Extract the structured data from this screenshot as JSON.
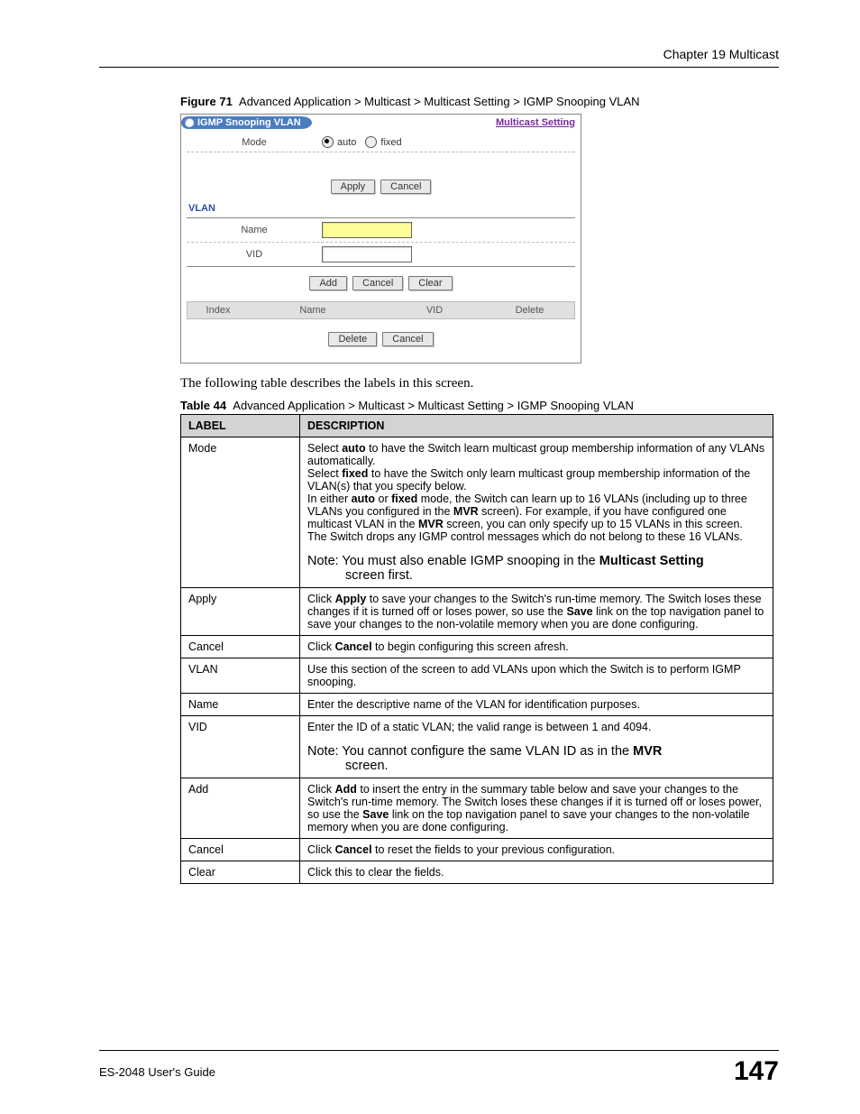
{
  "header": {
    "chapter": "Chapter 19 Multicast"
  },
  "figure": {
    "label": "Figure 71",
    "caption": "Advanced Application > Multicast > Multicast Setting > IGMP Snooping VLAN"
  },
  "panel": {
    "tab": "IGMP Snooping VLAN",
    "link": "Multicast Setting",
    "mode_label": "Mode",
    "radio_auto": "auto",
    "radio_fixed": "fixed",
    "btn_apply": "Apply",
    "btn_cancel": "Cancel",
    "vlan_heading": "VLAN",
    "name_label": "Name",
    "vid_label": "VID",
    "btn_add": "Add",
    "btn_cancel2": "Cancel",
    "btn_clear": "Clear",
    "cols": {
      "index": "Index",
      "name": "Name",
      "vid": "VID",
      "delete": "Delete"
    },
    "btn_delete": "Delete",
    "btn_cancel3": "Cancel"
  },
  "body_text": "The following table describes the labels in this screen.",
  "table_caption": {
    "label": "Table 44",
    "caption": "Advanced Application > Multicast > Multicast Setting > IGMP Snooping VLAN"
  },
  "table_headers": {
    "label": "LABEL",
    "desc": "DESCRIPTION"
  },
  "rows": {
    "mode": {
      "label": "Mode",
      "p1a": "Select ",
      "p1b": "auto",
      "p1c": " to have the Switch learn multicast group membership information of any VLANs automatically.",
      "p2a": "Select ",
      "p2b": "fixed",
      "p2c": " to have the Switch only learn multicast group membership information of the VLAN(s) that you specify below.",
      "p3a": "In either ",
      "p3b": "auto",
      "p3c": " or ",
      "p3d": "fixed",
      "p3e": " mode, the Switch can learn up to 16 VLANs (including up to three VLANs you configured in the ",
      "p3f": "MVR",
      "p3g": " screen). For example, if you have configured one multicast VLAN in the ",
      "p3h": "MVR",
      "p3i": " screen, you can only specify up to 15 VLANs in this screen.",
      "p4": "The Switch drops any IGMP control messages which do not belong to these 16 VLANs.",
      "note_a": "Note: You must also enable IGMP snooping in the ",
      "note_b": "Multicast Setting",
      "note_c": " screen first."
    },
    "apply": {
      "label": "Apply",
      "a": "Click ",
      "b": "Apply",
      "c": " to save your changes to the Switch's run-time memory. The Switch loses these changes if it is turned off or loses power, so use the ",
      "d": "Save",
      "e": " link on the top navigation panel to save your changes to the non-volatile memory when you are done configuring."
    },
    "cancel": {
      "label": "Cancel",
      "a": "Click ",
      "b": "Cancel",
      "c": " to begin configuring this screen afresh."
    },
    "vlan": {
      "label": "VLAN",
      "text": "Use this section of the screen to add VLANs upon which the Switch is to perform IGMP snooping."
    },
    "name": {
      "label": "Name",
      "text": "Enter the descriptive name of the VLAN for identification purposes."
    },
    "vid": {
      "label": "VID",
      "text": "Enter the ID of a static VLAN; the valid range is between 1 and 4094.",
      "note_a": "Note: You cannot configure the same VLAN ID as in the ",
      "note_b": "MVR",
      "note_c": " screen."
    },
    "add": {
      "label": "Add",
      "a": "Click ",
      "b": "Add",
      "c": " to insert the entry in the summary table below and save your changes to the Switch's run-time memory. The Switch loses these changes if it is turned off or loses power, so use the ",
      "d": "Save",
      "e": " link on the top navigation panel to save your changes to the non-volatile memory when you are done configuring."
    },
    "cancel2": {
      "label": "Cancel",
      "a": "Click ",
      "b": "Cancel",
      "c": " to reset the fields to your previous configuration."
    },
    "clear": {
      "label": "Clear",
      "text": "Click this to clear the fields."
    }
  },
  "footer": {
    "guide": "ES-2048 User's Guide",
    "page": "147"
  }
}
